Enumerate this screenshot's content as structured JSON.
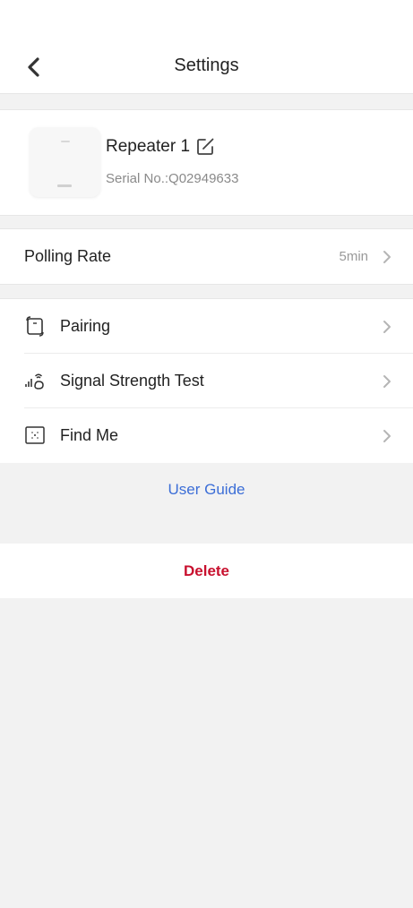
{
  "header": {
    "title": "Settings",
    "back_icon": "back-arrow-icon"
  },
  "device": {
    "name": "Repeater 1",
    "serial": "Serial No.:Q02949633",
    "edit_icon": "edit-icon"
  },
  "polling": {
    "label": "Polling Rate",
    "value": "5min"
  },
  "actions": [
    {
      "label": "Pairing",
      "icon": "pairing-icon"
    },
    {
      "label": "Signal Strength Test",
      "icon": "signal-strength-icon"
    },
    {
      "label": "Find Me",
      "icon": "find-me-icon"
    }
  ],
  "guide": {
    "label": "User Guide"
  },
  "delete": {
    "label": "Delete"
  },
  "colors": {
    "link": "#3c6ed7",
    "danger": "#c8102e",
    "background": "#f2f2f2"
  }
}
